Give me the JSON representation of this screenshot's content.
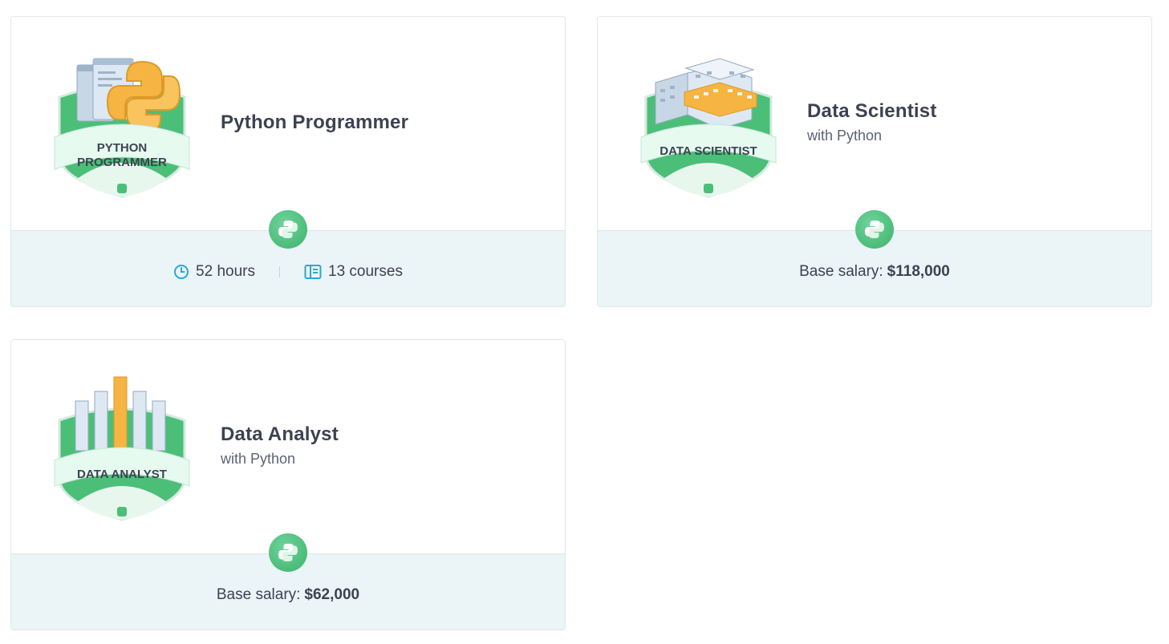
{
  "cards": [
    {
      "title": "Python Programmer",
      "subtitle": "",
      "badge_text": [
        "PYTHON",
        "PROGRAMMER"
      ],
      "technology_icon": "python-icon",
      "hours": "52 hours",
      "courses": "13 courses",
      "salary_label": "",
      "salary_value": ""
    },
    {
      "title": "Data Scientist",
      "subtitle": "with Python",
      "badge_text": [
        "DATA SCIENTIST"
      ],
      "technology_icon": "python-icon",
      "salary_label": "Base salary:",
      "salary_value": "$118,000"
    },
    {
      "title": "Data Analyst",
      "subtitle": "with Python",
      "badge_text": [
        "DATA ANALYST"
      ],
      "technology_icon": "python-icon",
      "salary_label": "Base salary:",
      "salary_value": "$62,000"
    }
  ],
  "colors": {
    "badge_green": "#4bbf78",
    "ribbon": "#e6faf0",
    "footer_bg": "#ebf4f7",
    "icon_blue": "#2aa8d4",
    "text_dark": "#3d4251"
  }
}
